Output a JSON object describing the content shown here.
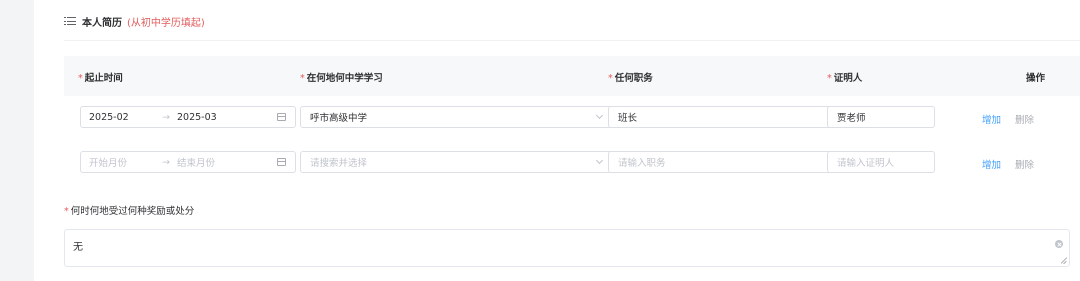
{
  "section": {
    "title": "本人简历",
    "hint": "(从初中学历填起)"
  },
  "table": {
    "headers": {
      "time": "起止时间",
      "school": "在何地何中学学习",
      "position": "任何职务",
      "witness": "证明人",
      "actions": "操作"
    },
    "rows": [
      {
        "start": "2025-02",
        "separator": "→",
        "end": "2025-03",
        "school": "呼市高级中学",
        "position": "班长",
        "witness": "贾老师",
        "add": "增加",
        "delete": "删除"
      },
      {
        "start_placeholder": "开始月份",
        "separator": "→",
        "end_placeholder": "结束月份",
        "school_placeholder": "请搜索并选择",
        "position_placeholder": "请输入职务",
        "witness_placeholder": "请输入证明人",
        "add": "增加",
        "delete": "删除"
      }
    ]
  },
  "reward": {
    "label": "何时何地受过何种奖励或处分",
    "value": "无"
  },
  "colors": {
    "required": "#e25c5c",
    "link": "#409eff",
    "placeholder": "#c0c4cc"
  }
}
